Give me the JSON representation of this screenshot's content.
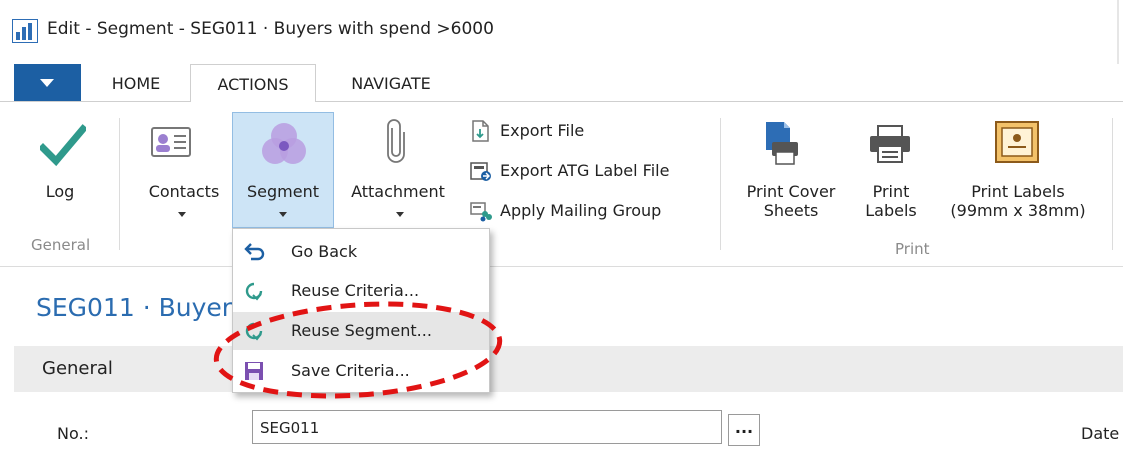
{
  "window": {
    "title": "Edit - Segment - SEG011 · Buyers with spend >6000"
  },
  "tabs": [
    {
      "label": "HOME"
    },
    {
      "label": "ACTIONS"
    },
    {
      "label": "NAVIGATE"
    }
  ],
  "ribbon": {
    "general": {
      "group_label": "General",
      "log": "Log",
      "contacts": "Contacts",
      "segment": "Segment",
      "attachment": "Attachment",
      "export_file": "Export File",
      "export_atg": "Export ATG Label File",
      "apply_mailing": "Apply Mailing Group"
    },
    "print": {
      "group_label": "Print",
      "cover_line1": "Print Cover",
      "cover_line2": "Sheets",
      "labels_line1": "Print",
      "labels_line2": "Labels",
      "labels99_line1": "Print Labels",
      "labels99_line2": "(99mm x 38mm)"
    }
  },
  "menu": {
    "items": [
      {
        "label": "Go Back",
        "icon": "undo-arrow-icon"
      },
      {
        "label": "Reuse Criteria...",
        "icon": "reuse-icon"
      },
      {
        "label": "Reuse Segment...",
        "icon": "reuse-icon"
      },
      {
        "label": "Save Criteria...",
        "icon": "save-icon"
      }
    ]
  },
  "page": {
    "title": "SEG011 · Buyers with spend >6000",
    "fasttab": "General",
    "no_label": "No.:",
    "no_value": "SEG011",
    "ellipsis": "...",
    "date_label": "Date"
  },
  "colors": {
    "accent": "#1c5fa3",
    "title_blue": "#2b6cb0",
    "annotation_red": "#e11414",
    "check_green": "#2f9a8c",
    "segment_purple": "#9b7fd0"
  }
}
